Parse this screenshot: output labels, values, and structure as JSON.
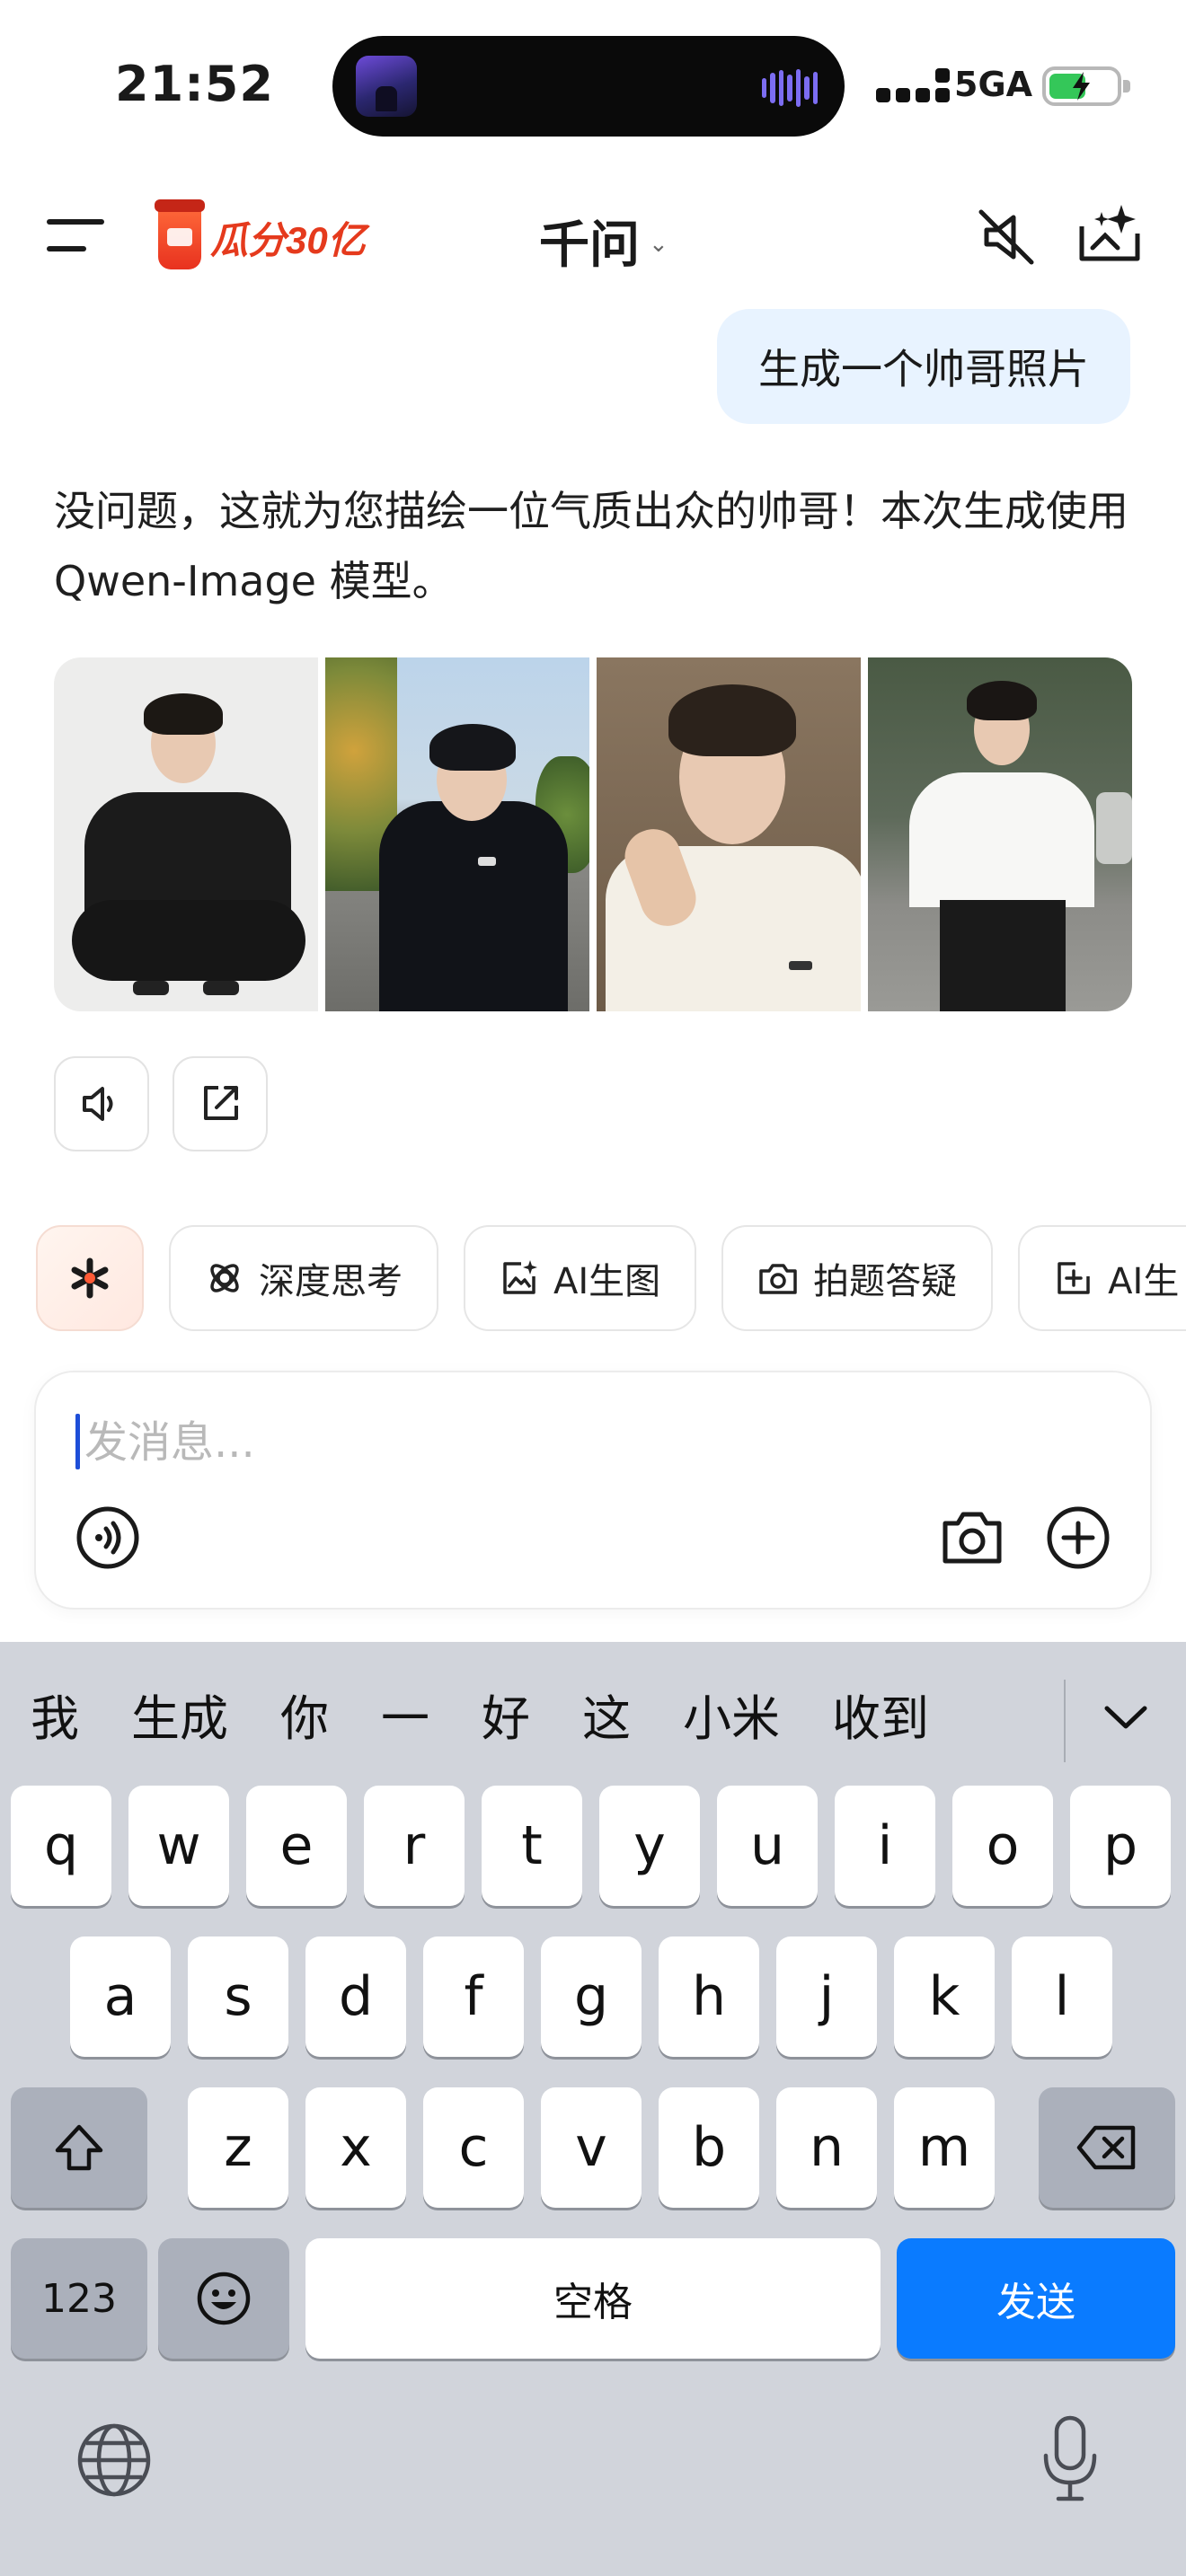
{
  "status_bar": {
    "time": "21:52",
    "network": "5GA"
  },
  "header": {
    "promo": "瓜分30亿",
    "title": "千问",
    "title_chevron": "⌄"
  },
  "chat": {
    "user_message": "生成一个帅哥照片",
    "assistant_reply": "没问题，这就为您描绘一位气质出众的帅哥！本次生成使用 Qwen-Image 模型。",
    "image_count": 4
  },
  "chips": [
    {
      "label": "",
      "icon": "sparkle-icon"
    },
    {
      "label": "深度思考",
      "icon": "think-icon"
    },
    {
      "label": "AI生图",
      "icon": "image-gen-icon"
    },
    {
      "label": "拍题答疑",
      "icon": "camera-question-icon"
    },
    {
      "label": "AI生",
      "icon": "ai-create-icon"
    }
  ],
  "composer": {
    "placeholder": "发消息..."
  },
  "keyboard": {
    "suggestions": [
      "我",
      "生成",
      "你",
      "一",
      "好",
      "这",
      "小米",
      "收到"
    ],
    "row1": [
      "q",
      "w",
      "e",
      "r",
      "t",
      "y",
      "u",
      "i",
      "o",
      "p"
    ],
    "row2": [
      "a",
      "s",
      "d",
      "f",
      "g",
      "h",
      "j",
      "k",
      "l"
    ],
    "row3": [
      "z",
      "x",
      "c",
      "v",
      "b",
      "n",
      "m"
    ],
    "numbers_label": "123",
    "space_label": "空格",
    "send_label": "发送"
  },
  "colors": {
    "accent_blue": "#0a7bff",
    "user_bubble": "#e8f3ff",
    "promo_red": "#e53a1d",
    "battery_green": "#34c759",
    "keyboard_bg": "#d1d4db"
  }
}
